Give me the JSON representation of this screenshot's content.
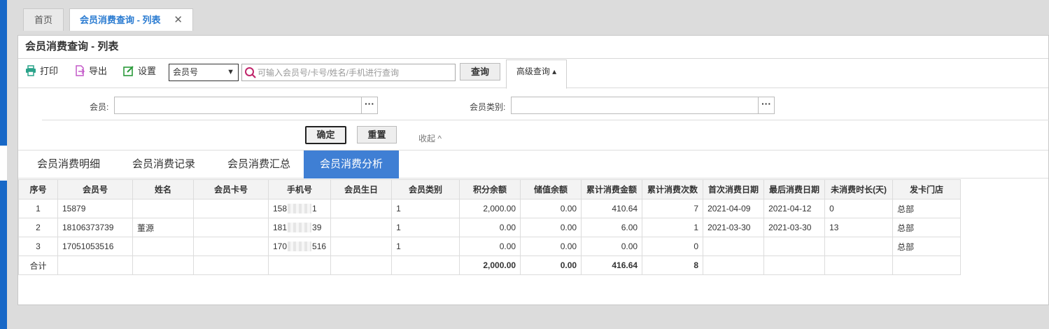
{
  "tabs": {
    "home": "首页",
    "active": "会员消费查询 - 列表",
    "close": "✕"
  },
  "panel": {
    "title": "会员消费查询 - 列表"
  },
  "toolbar": {
    "print": "打印",
    "export": "导出",
    "settings": "设置",
    "select_value": "会员号",
    "search_placeholder": "可输入会员号/卡号/姓名/手机进行查询",
    "query": "查询",
    "advanced": "高级查询 ▴"
  },
  "filter": {
    "member_label": "会员:",
    "member_type_label": "会员类别:",
    "ok": "确定",
    "reset": "重置",
    "collapse": "收起 ^"
  },
  "subtabs": [
    "会员消费明细",
    "会员消费记录",
    "会员消费汇总",
    "会员消费分析"
  ],
  "table": {
    "headers": [
      "序号",
      "会员号",
      "姓名",
      "会员卡号",
      "手机号",
      "会员生日",
      "会员类别",
      "积分余额",
      "储值余额",
      "累计消费金额",
      "累计消费次数",
      "首次消费日期",
      "最后消费日期",
      "未消费时长(天)",
      "发卡门店"
    ],
    "rows": [
      {
        "no": "1",
        "member_no": "15879",
        "name": "",
        "card": "",
        "phone_a": "158",
        "phone_b": "1",
        "birthday": "",
        "type": "1",
        "points": "2,000.00",
        "stored": "0.00",
        "total_amount": "410.64",
        "total_count": "7",
        "first_date": "2021-04-09",
        "last_date": "2021-04-12",
        "idle_days": "0",
        "store": "总部"
      },
      {
        "no": "2",
        "member_no": "18106373739",
        "name": "董源",
        "card": "",
        "phone_a": "181",
        "phone_b": "39",
        "birthday": "",
        "type": "1",
        "points": "0.00",
        "stored": "0.00",
        "total_amount": "6.00",
        "total_count": "1",
        "first_date": "2021-03-30",
        "last_date": "2021-03-30",
        "idle_days": "13",
        "store": "总部"
      },
      {
        "no": "3",
        "member_no": "17051053516",
        "name": "",
        "card": "",
        "phone_a": "170",
        "phone_b": "516",
        "birthday": "",
        "type": "1",
        "points": "0.00",
        "stored": "0.00",
        "total_amount": "0.00",
        "total_count": "0",
        "first_date": "",
        "last_date": "",
        "idle_days": "",
        "store": "总部"
      }
    ],
    "total": {
      "label": "合计",
      "points": "2,000.00",
      "stored": "0.00",
      "total_amount": "416.64",
      "total_count": "8"
    }
  },
  "colors": {
    "accent": "#3f7fd4",
    "tab_text": "#2a7bd1"
  }
}
